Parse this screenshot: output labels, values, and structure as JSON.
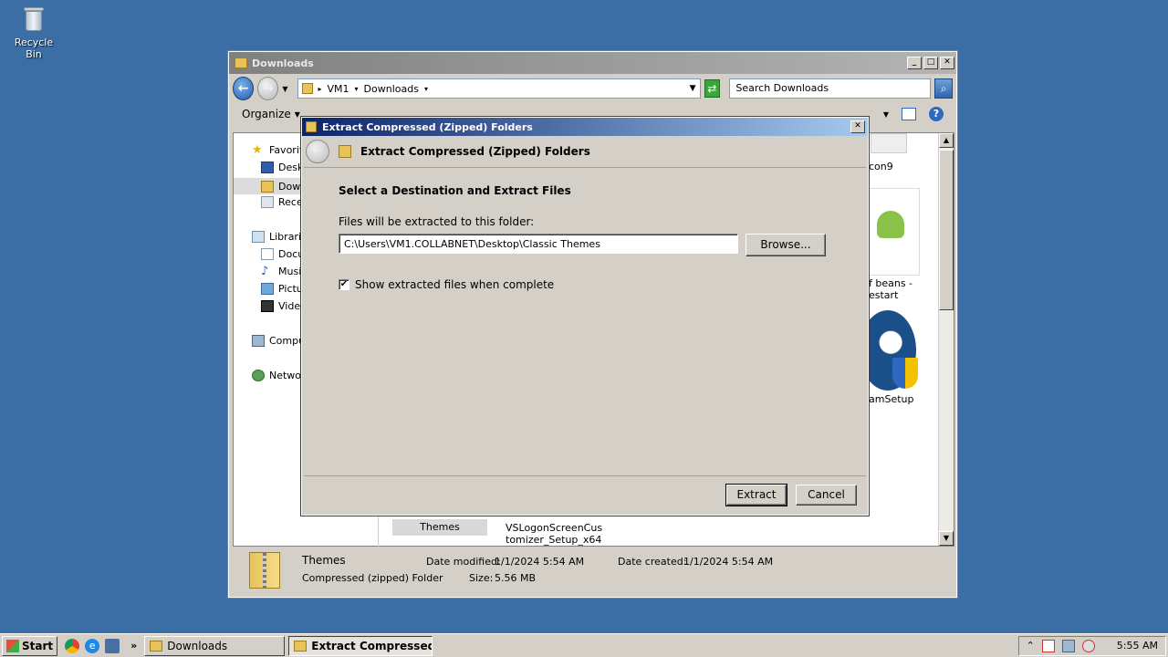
{
  "desktop": {
    "recycle_bin_label": "Recycle Bin"
  },
  "explorer": {
    "title": "Downloads",
    "address": {
      "segments": [
        "VM1",
        "Downloads"
      ]
    },
    "search_placeholder": "Search Downloads",
    "toolbar": {
      "organize": "Organize"
    },
    "nav": {
      "favorites": "Favorit",
      "desktop": "Deskt",
      "downloads": "Down",
      "recent": "Rece",
      "libraries": "Librarie",
      "documents": "Docu",
      "music": "Music",
      "pictures": "Pictur",
      "videos": "Videc",
      "computer": "Compu",
      "network": "Networ"
    },
    "files": {
      "icon9": "con9",
      "beans_1": "f beans -",
      "beans_2": "estart",
      "steam": "amSetup",
      "themes": "Themes",
      "vslogon_1": "VSLogonScreenCus",
      "vslogon_2": "tomizer_Setup_x64"
    },
    "details": {
      "name": "Themes",
      "type": "Compressed (zipped) Folder",
      "modified_label": "Date modified:",
      "modified_value": "1/1/2024 5:54 AM",
      "created_label": "Date created:",
      "created_value": "1/1/2024 5:54 AM",
      "size_label": "Size:",
      "size_value": "5.56 MB"
    }
  },
  "dialog": {
    "title": "Extract Compressed (Zipped) Folders",
    "header": "Extract Compressed (Zipped) Folders",
    "section_title": "Select a Destination and Extract Files",
    "field_label": "Files will be extracted to this folder:",
    "path_value": "C:\\Users\\VM1.COLLABNET\\Desktop\\Classic Themes",
    "browse_label": "Browse...",
    "checkbox_label": "Show extracted files when complete",
    "checkbox_checked": true,
    "extract_label": "Extract",
    "cancel_label": "Cancel"
  },
  "taskbar": {
    "start_label": "Start",
    "tasks": [
      {
        "label": "Downloads"
      },
      {
        "label": "Extract Compressed (..."
      }
    ],
    "clock": "5:55 AM"
  }
}
